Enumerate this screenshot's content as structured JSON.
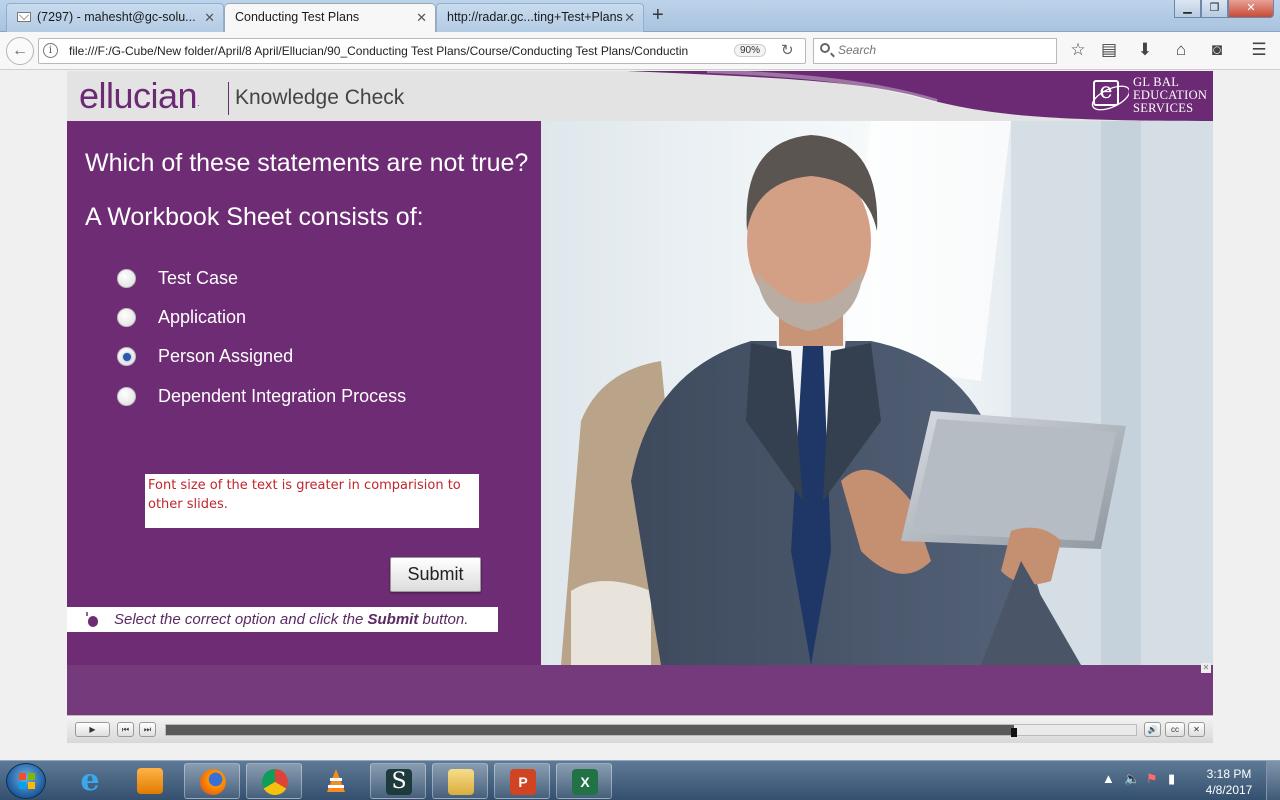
{
  "browser": {
    "tabs": [
      {
        "title": "(7297) - mahesht@gc-solu...",
        "active": false
      },
      {
        "title": "Conducting Test Plans",
        "active": true
      },
      {
        "title": "http://radar.gc...ting+Test+Plans",
        "active": false
      }
    ],
    "url": "file:///F:/G-Cube/New folder/April/8 April/Ellucian/90_Conducting Test Plans/Course/Conducting Test Plans/Conductin",
    "zoom": "90%",
    "search_placeholder": "Search"
  },
  "course": {
    "brand": "ellucian",
    "brand_mark": ".",
    "header_title": "Knowledge Check",
    "logo_lines": [
      "GL  BAL",
      "EDUCATION",
      "SERVICES"
    ],
    "logo_letter": "e",
    "question_line1": "Which of these statements are not true?",
    "question_line2": "A Workbook Sheet consists of:",
    "options": [
      {
        "label": "Test Case",
        "selected": false
      },
      {
        "label": "Application",
        "selected": false
      },
      {
        "label": "Person Assigned",
        "selected": true
      },
      {
        "label": "Dependent Integration Process",
        "selected": false
      }
    ],
    "review_note": " Font size of the text is greater in comparision to other slides.",
    "submit_label": "Submit",
    "instruction_prefix": "Select the correct option and click the ",
    "instruction_bold": "Submit",
    "instruction_suffix": " button.",
    "progress_fraction": 0.874
  },
  "taskbar": {
    "apps": [
      "internet-explorer",
      "media-player",
      "firefox",
      "chrome",
      "vlc",
      "snagit",
      "file-explorer",
      "powerpoint",
      "excel"
    ],
    "time": "3:18 PM",
    "date": "4/8/2017"
  },
  "colors": {
    "brand_purple": "#6e2c74",
    "footer_purple": "#753a7b",
    "note_red": "#c0262b"
  }
}
